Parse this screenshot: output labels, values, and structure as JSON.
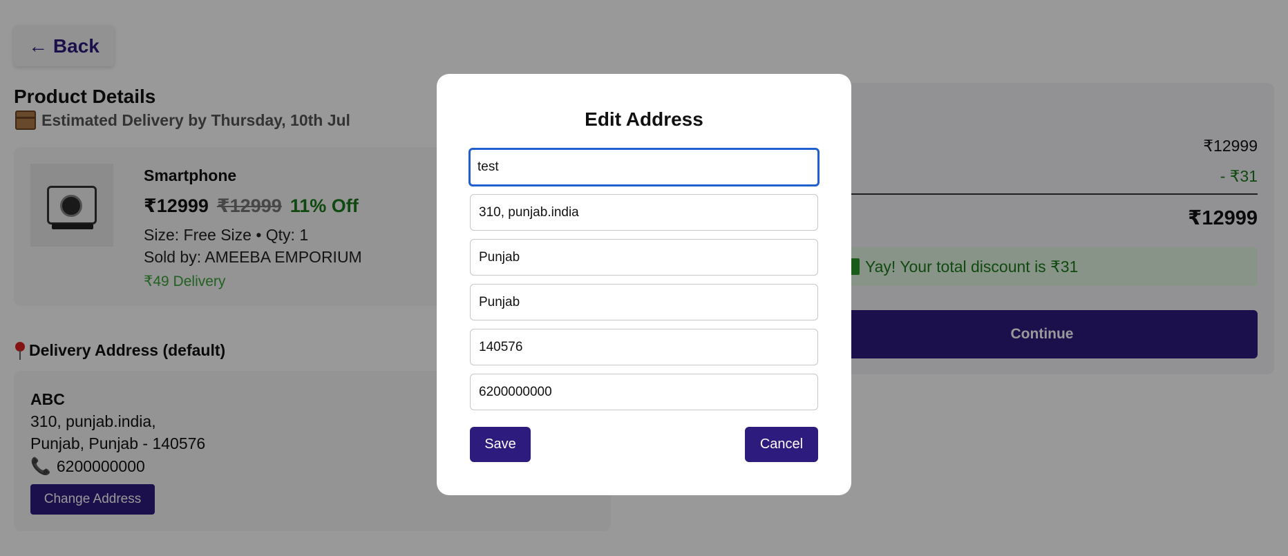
{
  "header": {
    "back_label": "← Back"
  },
  "product_section": {
    "title": "Product Details",
    "estimated_delivery": "Estimated Delivery by Thursday, 10th Jul"
  },
  "product": {
    "name": "Smartphone",
    "price": "₹12999",
    "mrp": "₹12999",
    "discount": "11% Off",
    "size_qty": "Size: Free Size • Qty: 1",
    "seller": "Sold by: AMEEBA EMPORIUM",
    "delivery_fee": "₹49 Delivery"
  },
  "address_section": {
    "title": "Delivery Address (default)",
    "name": "ABC",
    "line1": "310, punjab.india,",
    "line2": "Punjab, Punjab - 140576",
    "phone": "6200000000",
    "change_label": "Change Address"
  },
  "summary": {
    "mrp": "₹12999",
    "discount": "- ₹31",
    "total": "₹12999",
    "banner": "Yay! Your total discount is ₹31",
    "continue_label": "Continue"
  },
  "modal": {
    "title": "Edit Address",
    "fields": {
      "name": "test",
      "address": "310, punjab.india",
      "city": "Punjab",
      "state": "Punjab",
      "pincode": "140576",
      "phone": "6200000000"
    },
    "save_label": "Save",
    "cancel_label": "Cancel"
  },
  "colors": {
    "accent": "#2d1b7e",
    "success": "#1a7a1a",
    "focus": "#1f5fcf"
  }
}
